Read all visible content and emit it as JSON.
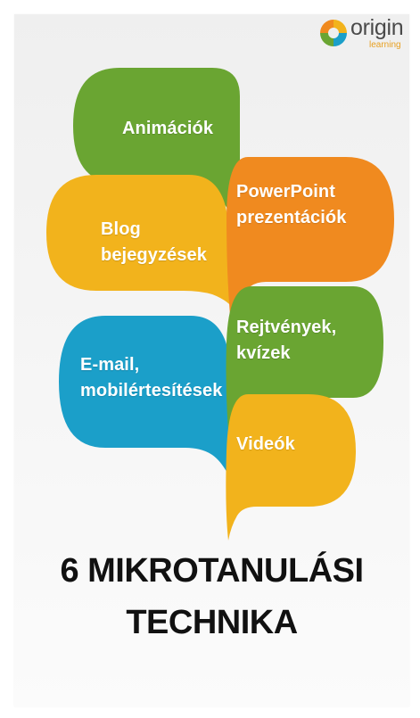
{
  "brand": {
    "name": "origin",
    "sub": "learning"
  },
  "bubbles": {
    "animaciok": "Animációk",
    "blog_line1": "Blog",
    "blog_line2": "bejegyzések",
    "email_line1": "E-mail,",
    "email_line2": "mobilértesítések",
    "powerpoint_line1": "PowerPoint",
    "powerpoint_line2": "prezentációk",
    "rejtvenyek_line1": "Rejtvények,",
    "rejtvenyek_line2": "kvízek",
    "videok": "Videók"
  },
  "title": {
    "line1": "6 MIKROTANULÁSI",
    "line2": "TECHNIKA"
  },
  "colors": {
    "green": "#6aa532",
    "yellow": "#f2b31c",
    "blue": "#1b9fc9",
    "orange": "#f08a1f"
  }
}
